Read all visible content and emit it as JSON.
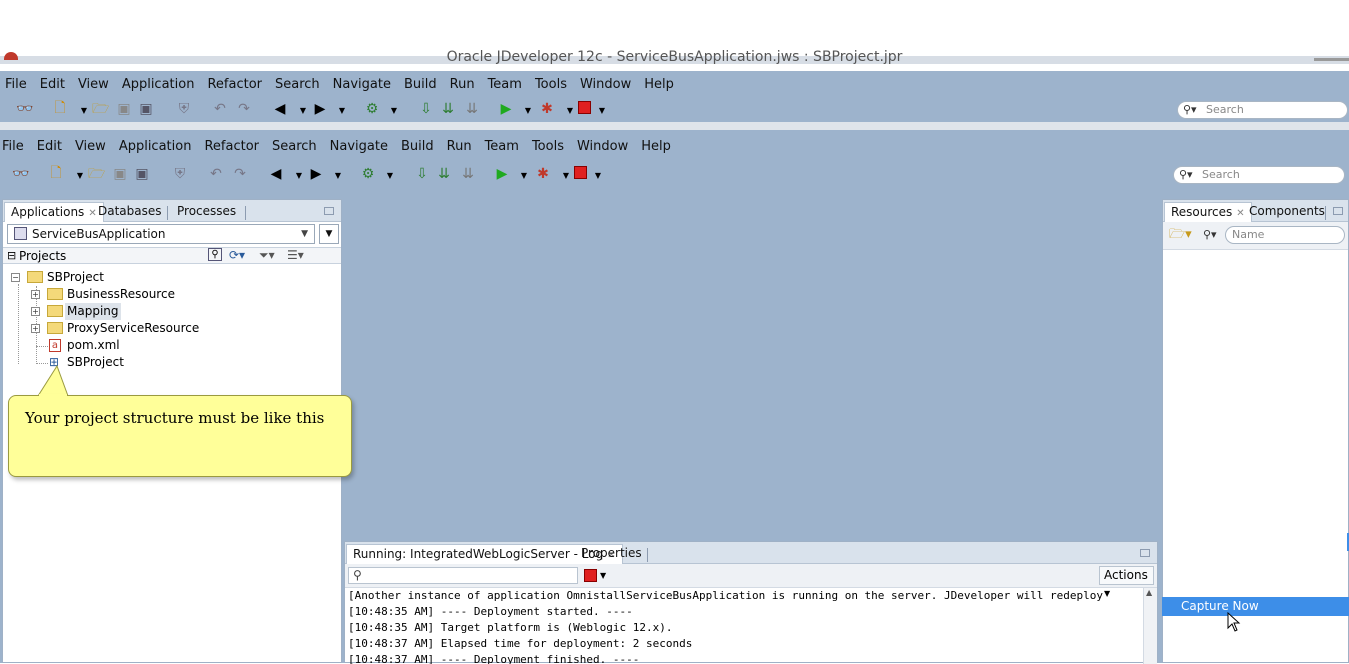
{
  "window": {
    "title": "Oracle JDeveloper 12c - ServiceBusApplication.jws : SBProject.jpr"
  },
  "menu": [
    "File",
    "Edit",
    "View",
    "Application",
    "Refactor",
    "Search",
    "Navigate",
    "Build",
    "Run",
    "Team",
    "Tools",
    "Window",
    "Help"
  ],
  "toolbar": {
    "search_placeholder": "Search"
  },
  "left_panel": {
    "tabs": [
      "Applications",
      "Databases",
      "Processes"
    ],
    "app_selector": "ServiceBusApplication",
    "projects_header": "Projects",
    "tree": [
      {
        "label": "SBProject",
        "type": "project-folder",
        "expanded": true
      },
      {
        "label": "BusinessResource",
        "type": "folder"
      },
      {
        "label": "Mapping",
        "type": "folder",
        "selected": true
      },
      {
        "label": "ProxyServiceResource",
        "type": "folder"
      },
      {
        "label": "pom.xml",
        "type": "xml-file"
      },
      {
        "label": "SBProject",
        "type": "project-file"
      }
    ]
  },
  "callout": {
    "text": "Your project structure must be like this"
  },
  "right_panel": {
    "tabs": [
      "Resources",
      "Components"
    ],
    "name_placeholder": "Name"
  },
  "log_panel": {
    "tabs": [
      "Running: IntegratedWebLogicServer - Log",
      "Properties"
    ],
    "actions_label": "Actions",
    "lines": [
      "[Another instance of application OmnistallServiceBusApplication is running on the server.  JDeveloper will redeploy",
      "[10:48:35 AM] ----  Deployment started.  ----",
      "[10:48:35 AM] Target platform is  (Weblogic 12.x).",
      "[10:48:37 AM] Elapsed time for deployment:  2 seconds",
      "[10:48:37 AM] ----  Deployment finished.  ----"
    ]
  },
  "popup": {
    "capture_label": "Capture Now"
  },
  "colors": {
    "chrome": "#9db3cc",
    "selection": "#3d8ee8",
    "callout": "#ffff99"
  }
}
